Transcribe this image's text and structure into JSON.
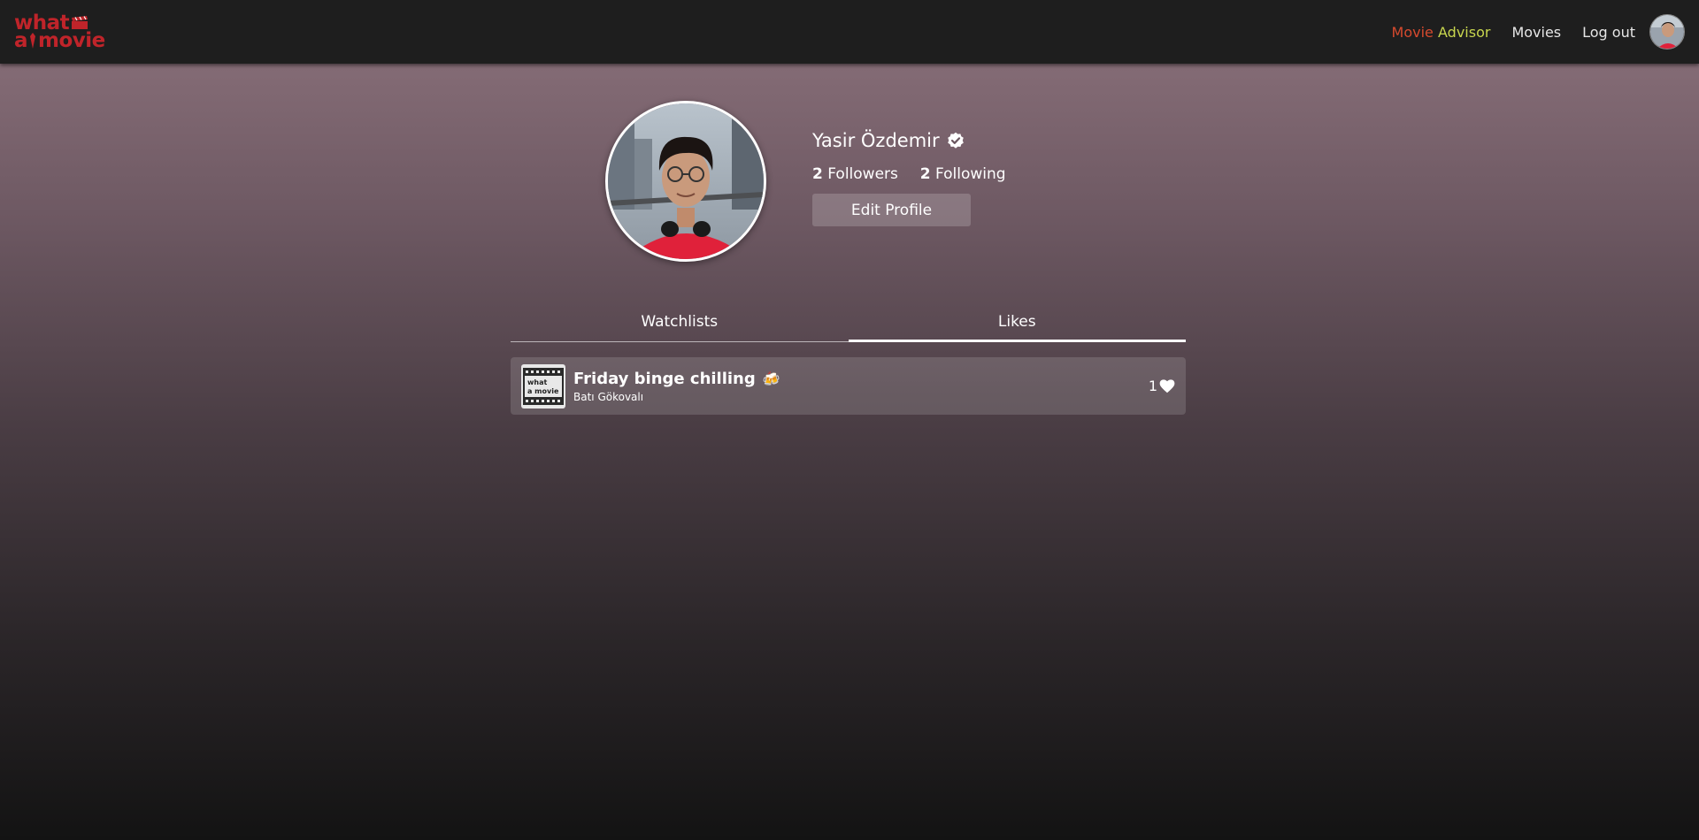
{
  "logo": {
    "line1": "what",
    "line2_a": "a",
    "line2_b": "movie"
  },
  "nav": {
    "advisor_movie": "Movie",
    "advisor_advisor": "Advisor",
    "movies": "Movies",
    "logout": "Log out"
  },
  "profile": {
    "name": "Yasir Özdemir",
    "followers_count": "2",
    "followers_label": "Followers",
    "following_count": "2",
    "following_label": "Following",
    "edit_button": "Edit Profile"
  },
  "tabs": [
    {
      "label": "Watchlists",
      "active": false
    },
    {
      "label": "Likes",
      "active": true
    }
  ],
  "likes_list": [
    {
      "thumb_line1": "what",
      "thumb_line2": "a movie",
      "title": "Friday binge chilling",
      "emoji": "🍻",
      "owner": "Batı Gökovalı",
      "like_count": "1"
    }
  ],
  "colors": {
    "brand_red": "#c0242a",
    "advisor_movie": "#d64a2e",
    "advisor_advisor": "#c8d64e",
    "navbar": "#1e1e1e"
  },
  "icons": {
    "verified": "check-badge-icon",
    "heart": "heart-icon"
  }
}
